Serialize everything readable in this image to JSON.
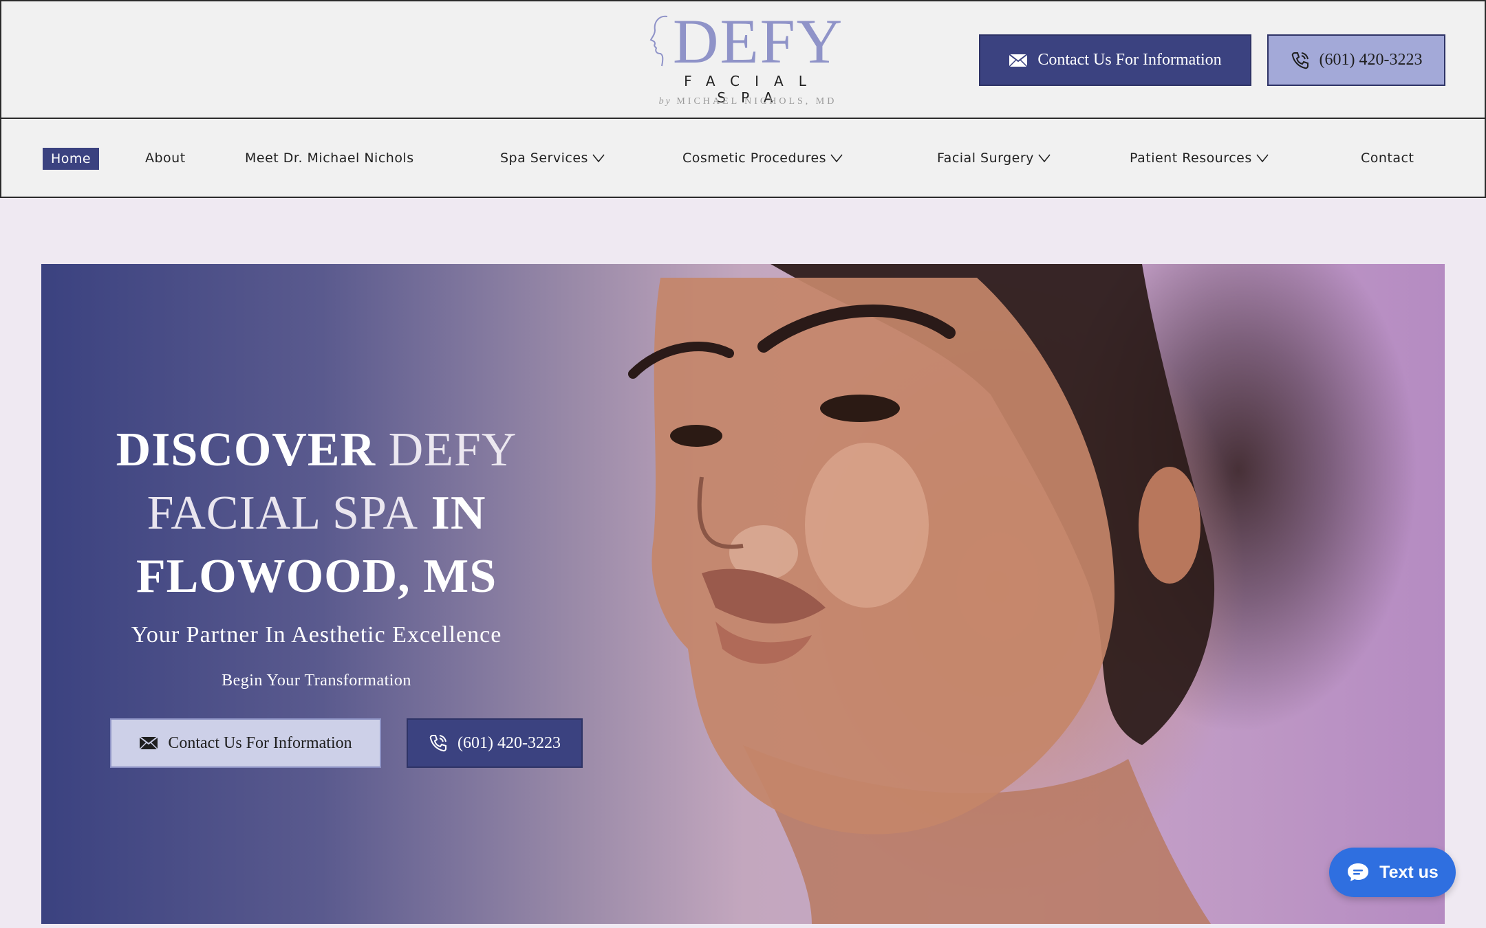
{
  "header": {
    "logo": {
      "word": "DEFY",
      "subtitle": "FACIAL SPA",
      "by_prefix": "by",
      "by_name": "MICHAEL NICHOLS, MD"
    },
    "contact_button": "Contact Us For Information",
    "phone_button": "(601) 420-3223",
    "contact_icon": "envelope-icon",
    "phone_icon": "phone-icon"
  },
  "nav": {
    "items": [
      {
        "label": "Home",
        "active": true,
        "dropdown": false
      },
      {
        "label": "About",
        "active": false,
        "dropdown": false
      },
      {
        "label": "Meet Dr. Michael Nichols",
        "active": false,
        "dropdown": false
      },
      {
        "label": "Spa Services",
        "active": false,
        "dropdown": true
      },
      {
        "label": "Cosmetic Procedures",
        "active": false,
        "dropdown": true
      },
      {
        "label": "Facial Surgery",
        "active": false,
        "dropdown": true
      },
      {
        "label": "Patient Resources",
        "active": false,
        "dropdown": true
      },
      {
        "label": "Contact",
        "active": false,
        "dropdown": false
      }
    ]
  },
  "hero": {
    "title_line1_a": "DISCOVER",
    "title_line1_b": "DEFY",
    "title_line2_a": "FACIAL SPA",
    "title_line2_b": "IN",
    "title_line3": "FLOWOOD, MS",
    "tagline": "Your Partner In Aesthetic Excellence",
    "begin": "Begin Your Transformation",
    "contact_button": "Contact Us For Information",
    "phone_button": "(601) 420-3223"
  },
  "widget": {
    "label": "Text us",
    "icon": "chat-bubble-icon"
  },
  "colors": {
    "brand_navy": "#3b4280",
    "brand_lavender": "#a3a9d8",
    "logo_purple": "#8f93c8",
    "widget_blue": "#2f6fe0"
  }
}
